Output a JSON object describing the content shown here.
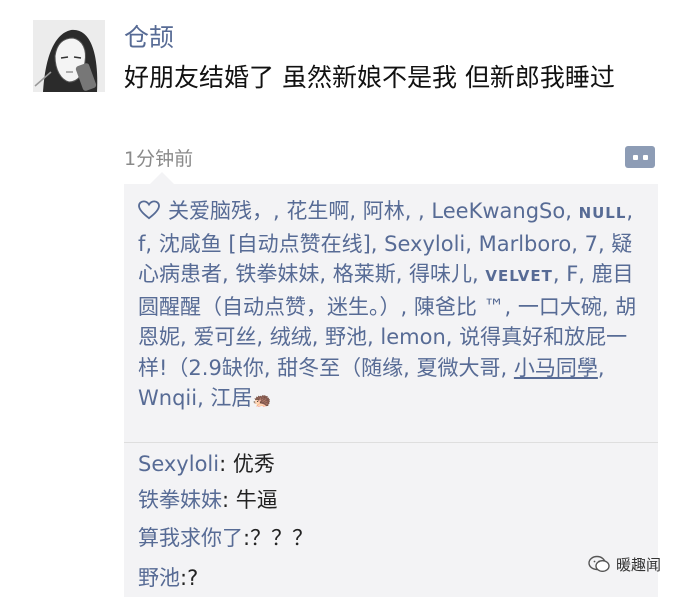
{
  "moment": {
    "username": "仓颉",
    "post_text": "好朋友结婚了 虽然新娘不是我 但新郎我睡过",
    "time": "1分钟前"
  },
  "likes": {
    "seg1": "关爱脑残，, 花生啊, 阿林, , LeeKwangSo, ",
    "null_name": "NULL",
    "seg2": ", f, 沈咸鱼 [自动点赞在线], Sexyloli, Marlboro, 7, 疑心病患者, 铁拳妹妹, 格莱斯, 得味儿, ",
    "velvet_name": "VELVET",
    "seg3": ", F, 鹿目圆醒醒（自动点赞，迷生。）, 陳爸比 ™, 一口大碗, 胡恩妮, 爱可丝, 绒绒, 野池, lemon, 说得真好和放屁一样!（2.9缺你, 甜冬至（随缘, 夏微大哥, ",
    "underlined_name": "小马同學",
    "seg4": ", Wnqii, 江居",
    "emoji": "🦔"
  },
  "comments": [
    {
      "name": "Sexyloli",
      "sep": ": ",
      "text": "优秀"
    },
    {
      "name": "铁拳妹妹",
      "sep": ": ",
      "text": "牛逼"
    },
    {
      "name": "算我求你了",
      "sep": ":",
      "text": "？？？"
    },
    {
      "name": "野池",
      "sep": ":",
      "text": "?"
    }
  ],
  "watermark": {
    "text": "暖趣闻"
  },
  "colors": {
    "link": "#576b95",
    "panel": "#f3f3f5",
    "text": "#111111",
    "muted": "#8a8a8a"
  }
}
